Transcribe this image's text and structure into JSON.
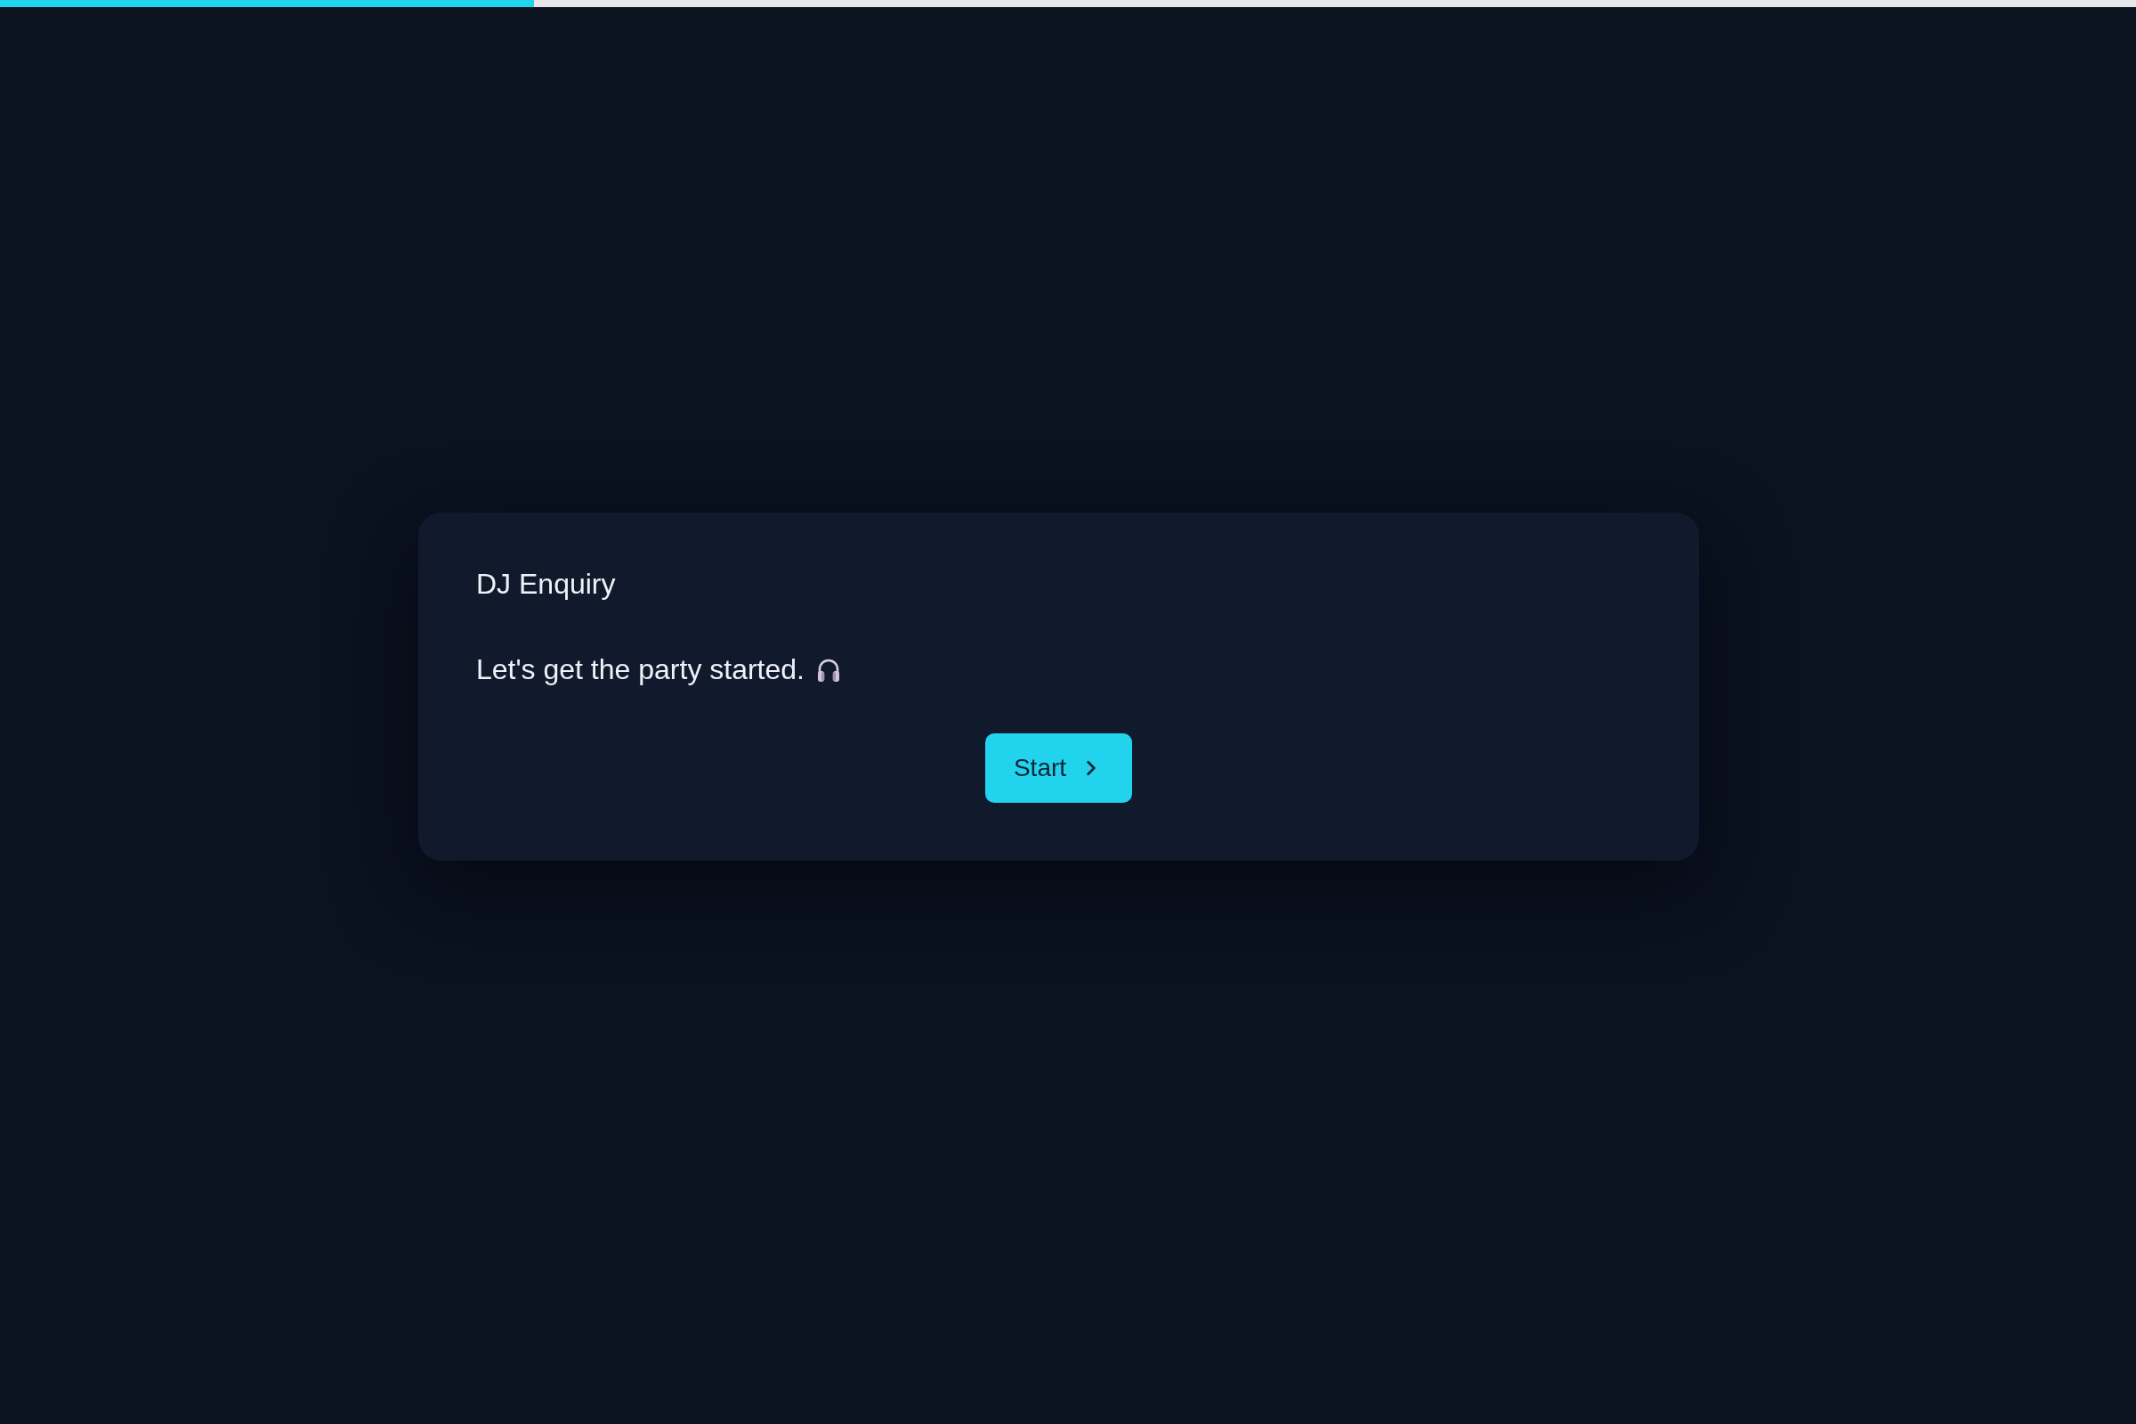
{
  "progress": {
    "level": 0.25
  },
  "card": {
    "title": "DJ Enquiry",
    "message": "Let's get the party started.",
    "start_button": {
      "label": "Start"
    }
  }
}
